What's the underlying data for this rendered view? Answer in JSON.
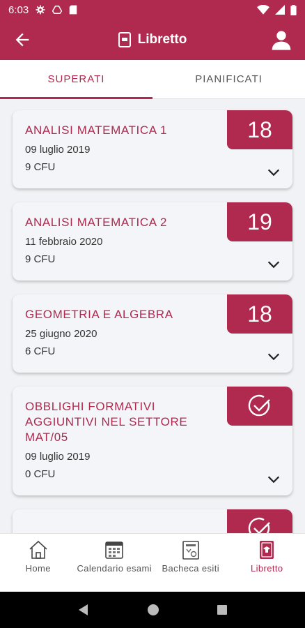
{
  "status_bar": {
    "time": "6:03"
  },
  "header": {
    "title": "Libretto"
  },
  "tabs": [
    {
      "label": "SUPERATI",
      "active": true
    },
    {
      "label": "PIANIFICATI",
      "active": false
    }
  ],
  "exams": [
    {
      "name": "ANALISI MATEMATICA 1",
      "date": "09 luglio 2019",
      "cfu": "9 CFU",
      "grade": "18"
    },
    {
      "name": "ANALISI MATEMATICA 2",
      "date": "11 febbraio 2020",
      "cfu": "9 CFU",
      "grade": "19"
    },
    {
      "name": "GEOMETRIA E ALGEBRA",
      "date": "25 giugno 2020",
      "cfu": "6 CFU",
      "grade": "18"
    },
    {
      "name": "OBBLIGHI FORMATIVI AGGIUNTIVI NEL SETTORE MAT/05",
      "date": "09 luglio 2019",
      "cfu": "0 CFU",
      "grade": ""
    }
  ],
  "bottom_nav": [
    {
      "label": "Home",
      "icon": "home-icon"
    },
    {
      "label": "Calendario esami",
      "icon": "calendar-icon"
    },
    {
      "label": "Bacheca esiti",
      "icon": "board-icon"
    },
    {
      "label": "Libretto",
      "icon": "book-icon",
      "active": true
    }
  ],
  "colors": {
    "primary": "#b0294e",
    "background": "#f1f2f5",
    "card": "#f4f5f8"
  }
}
